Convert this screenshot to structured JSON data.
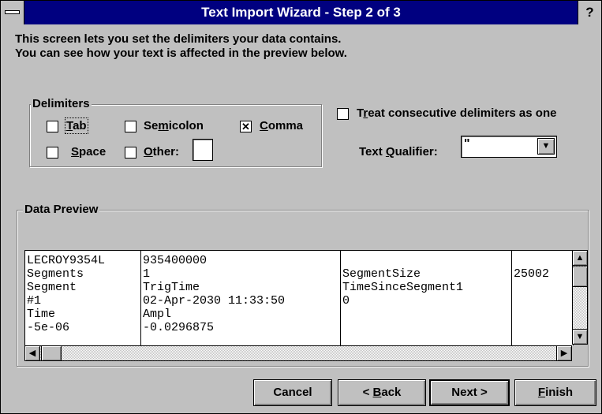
{
  "window": {
    "title": "Text Import Wizard - Step 2 of 3",
    "help": "?"
  },
  "instructions": [
    "This screen lets you set the delimiters your data contains.",
    "You can see how your text is affected in the preview below."
  ],
  "delimiters": {
    "legend": "Delimiters",
    "tab": {
      "pre": "",
      "key": "T",
      "post": "ab",
      "checked": false
    },
    "semicolon": {
      "pre": "Se",
      "key": "m",
      "post": "icolon",
      "checked": false
    },
    "comma": {
      "pre": "",
      "key": "C",
      "post": "omma",
      "checked": true,
      "mark": "✕"
    },
    "space": {
      "pre": "",
      "key": "S",
      "post": "pace",
      "checked": false
    },
    "other": {
      "pre": "",
      "key": "O",
      "post": "ther:",
      "checked": false,
      "value": ""
    }
  },
  "consecutive": {
    "pre": "T",
    "key": "r",
    "post": "eat consecutive delimiters as one",
    "checked": false
  },
  "qualifier": {
    "pre": "Text ",
    "key": "Q",
    "post": "ualifier:",
    "value": "\""
  },
  "preview": {
    "legend": "Data Preview",
    "columns": [
      [
        "LECROY9354L",
        "Segments",
        "Segment",
        "#1",
        "Time",
        "-5e-06"
      ],
      [
        "935400000",
        "1",
        "TrigTime",
        "02-Apr-2030 11:33:50",
        "Ampl",
        "-0.0296875"
      ],
      [
        "",
        "SegmentSize",
        "TimeSinceSegment1",
        "0",
        "",
        ""
      ],
      [
        "",
        "25002",
        "",
        "",
        "",
        ""
      ]
    ]
  },
  "buttons": {
    "cancel": "Cancel",
    "back": {
      "pre": "< ",
      "key": "B",
      "post": "ack"
    },
    "next": "Next >",
    "finish": {
      "pre": "",
      "key": "F",
      "post": "inish"
    }
  }
}
